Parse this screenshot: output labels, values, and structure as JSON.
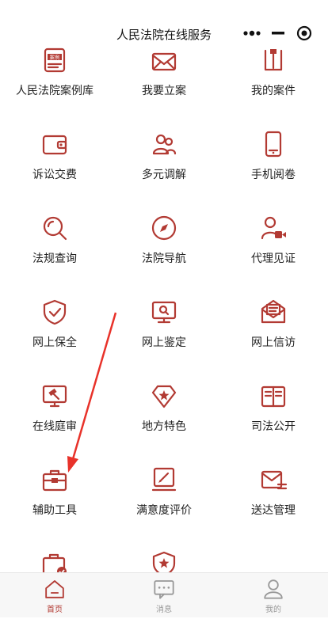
{
  "header": {
    "title": "人民法院在线服务"
  },
  "services": [
    {
      "label": "人民法院案例库",
      "icon": "case-library-icon",
      "badge": "案例"
    },
    {
      "label": "我要立案",
      "icon": "filing-envelope-icon"
    },
    {
      "label": "我的案件",
      "icon": "my-case-icon"
    },
    {
      "label": "诉讼交费",
      "icon": "wallet-icon"
    },
    {
      "label": "多元调解",
      "icon": "mediation-people-icon"
    },
    {
      "label": "手机阅卷",
      "icon": "mobile-icon"
    },
    {
      "label": "法规查询",
      "icon": "search-icon"
    },
    {
      "label": "法院导航",
      "icon": "compass-icon"
    },
    {
      "label": "代理见证",
      "icon": "video-witness-icon"
    },
    {
      "label": "网上保全",
      "icon": "shield-check-icon"
    },
    {
      "label": "网上鉴定",
      "icon": "monitor-search-icon"
    },
    {
      "label": "网上信访",
      "icon": "letter-icon"
    },
    {
      "label": "在线庭审",
      "icon": "gavel-screen-icon"
    },
    {
      "label": "地方特色",
      "icon": "star-diamond-icon"
    },
    {
      "label": "司法公开",
      "icon": "open-book-icon"
    },
    {
      "label": "辅助工具",
      "icon": "toolbox-icon"
    },
    {
      "label": "满意度评价",
      "icon": "rating-pen-icon"
    },
    {
      "label": "送达管理",
      "icon": "delivery-mail-icon"
    },
    {
      "label": "",
      "icon": "briefcase-check-icon"
    },
    {
      "label": "",
      "icon": "shield-star-icon"
    }
  ],
  "tabbar": [
    {
      "label": "首页",
      "icon": "home-icon",
      "active": true
    },
    {
      "label": "消息",
      "icon": "message-icon",
      "active": false
    },
    {
      "label": "我的",
      "icon": "user-icon",
      "active": false
    }
  ],
  "colors": {
    "accent": "#b23a33",
    "tab_inactive": "#999999",
    "annotation_arrow": "#e8322a"
  }
}
